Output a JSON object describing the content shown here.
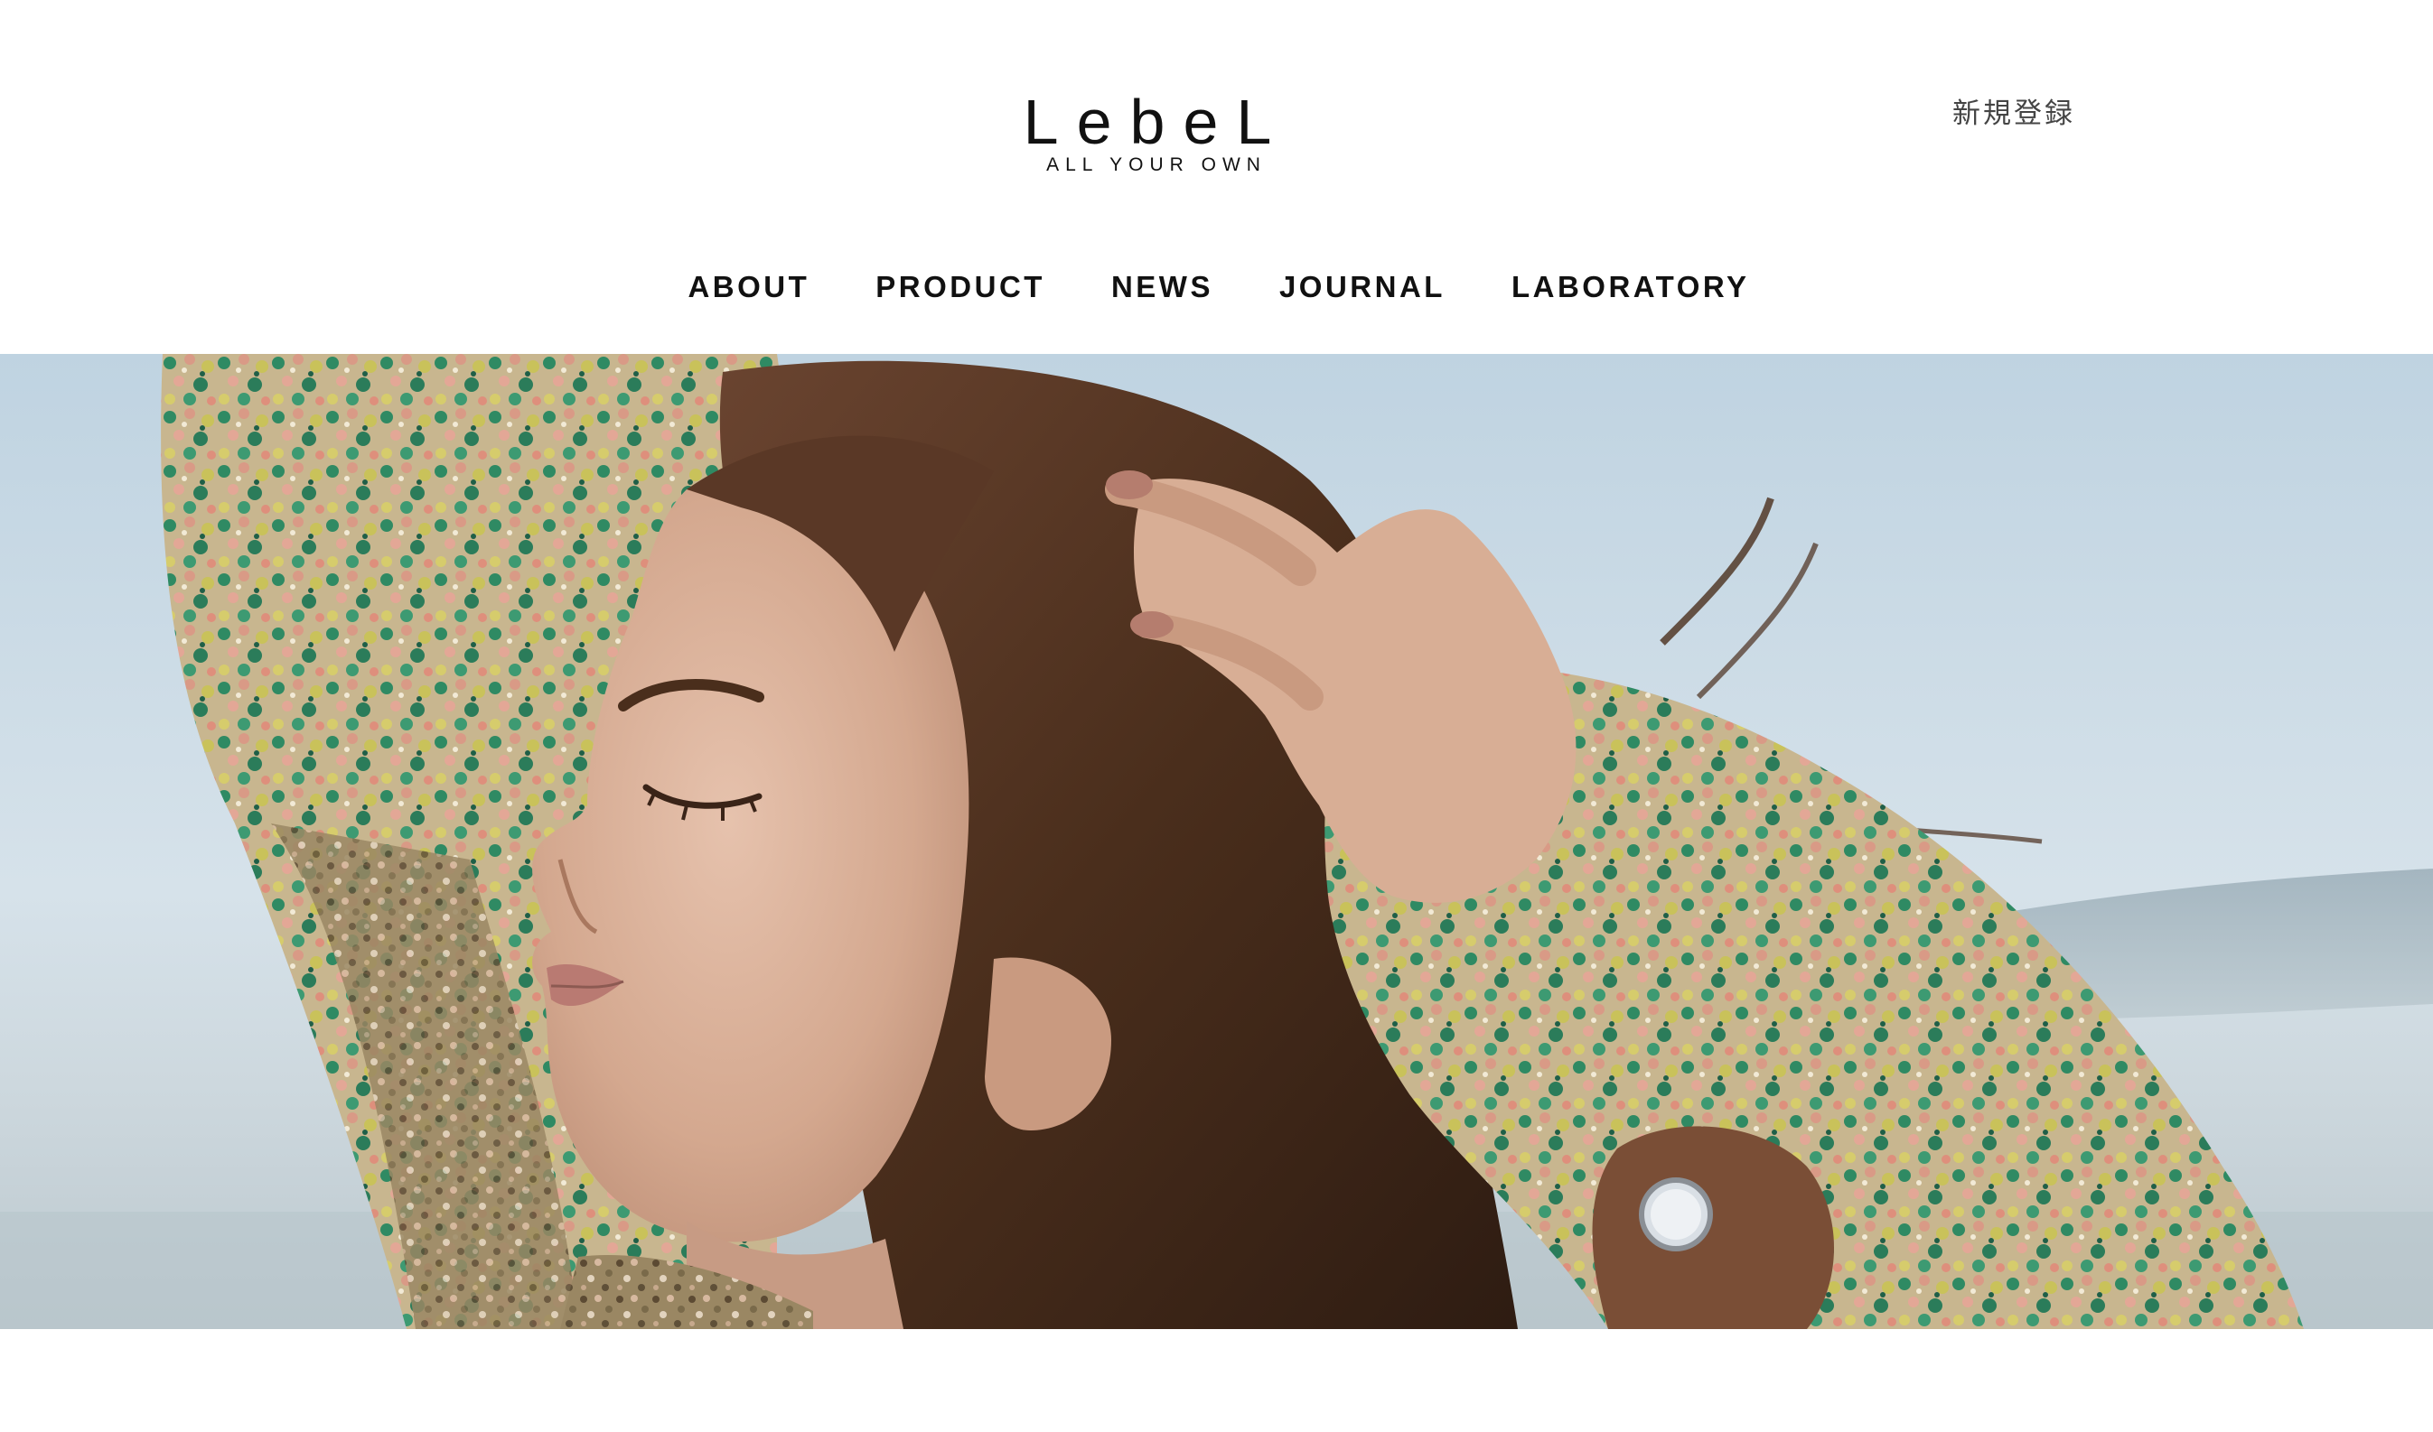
{
  "brand": {
    "logo_text": "LebeL",
    "tagline": "ALL YOUR OWN"
  },
  "header": {
    "register_label": "新規登録"
  },
  "nav": {
    "items": [
      {
        "label": "ABOUT"
      },
      {
        "label": "PRODUCT"
      },
      {
        "label": "NEWS"
      },
      {
        "label": "JOURNAL"
      },
      {
        "label": "LABORATORY"
      }
    ]
  },
  "hero": {
    "image": "woman-portrait-floral-blouse-seaside",
    "colors": {
      "sky": "#c5d6e2",
      "hair": "#4a2e1c",
      "skin": "#d8b09a",
      "fabric_green": "#2f8a63",
      "fabric_pink": "#d99a86",
      "fabric_yellow": "#c9c25a"
    }
  }
}
